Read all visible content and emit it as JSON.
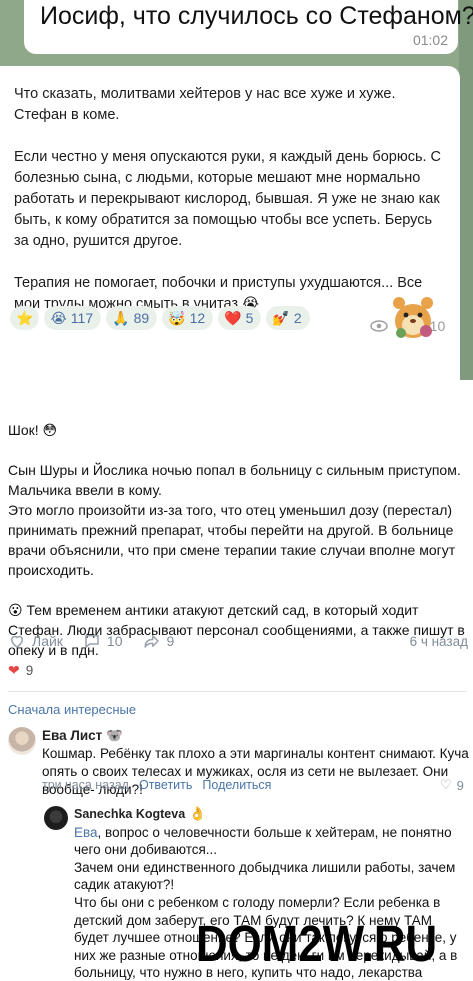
{
  "telegram": {
    "question": "Иосиф, что случилось со Стефаном?",
    "question_time": "01:02",
    "message_paragraphs": [
      "Что сказать, молитвами хейтеров у нас все хуже и хуже. Стефан в коме.",
      "Если честно у меня опускаются руки, я каждый день борюсь. С болезнью сына, с людьми, которые мешают мне нормально работать и перекрывают кислород, бывшая. Я уже не знаю как быть, к кому обратится за помощью чтобы все успеть. Берусь за одно, рушится другое.",
      "Терапия не помогает, побочки и приступы ухудшаются...  Все мои труды можно смыть в унитаз 😭"
    ],
    "reactions": [
      {
        "emoji": "⭐",
        "count": ""
      },
      {
        "emoji": "😭",
        "count": "117"
      },
      {
        "emoji": "🙏",
        "count": "89"
      },
      {
        "emoji": "🤯",
        "count": "12"
      },
      {
        "emoji": "❤️",
        "count": "5"
      },
      {
        "emoji": "💅",
        "count": "2"
      }
    ],
    "message_time": "1:10",
    "icons": {
      "views": "eye-icon",
      "sticker": "hamster-sticker-icon"
    }
  },
  "post": {
    "line1": "Шок! 😳",
    "para1": "Сын Шуры и Йослика ночью попал в больницу с сильным приступом. Мальчика ввели в кому.",
    "para2": "Это могло произойти из-за того, что отец уменьшил дозу (перестал) принимать прежний препарат, чтобы перейти на другой. В больнице врачи объяснили, что при смене терапии такие случаи вполне могут происходить.",
    "para3": "😮 Тем временем антики атакуют детский сад, в который ходит Стефан. Люди забрасывают персонал сообщениями, а также пишут в опеку и в пдн."
  },
  "actions": {
    "like_label": "Лайк",
    "comments_count": "10",
    "shares_count": "9",
    "time": "6 ч назад",
    "likes_count": "9"
  },
  "comments": {
    "sort_label": "Сначала интересные",
    "first": {
      "author": "Ева Лист",
      "author_badge": "🐨",
      "text": "Кошмар. Ребёнку так плохо а эти маргиналы контент снимают. Куча опять о своих телесах и мужиках, осля из сети не вылезает. Они вообще- люди?!",
      "time": "три часа назад",
      "reply_label": "Ответить",
      "share_label": "Поделиться",
      "likes": "9"
    },
    "second": {
      "author": "Sanechka Kogteva",
      "author_badge": "👌",
      "mention": "Ева",
      "text_line1": ", вопрос о человечности больше к хейтерам, не понятно чего они добиваются...",
      "text_line2": "Зачем они единственного добыдчика лишили работы, зачем садик атакуют?!",
      "text_line3": "Что бы они с ребенком с голоду померли? Если ребенка в детский дом заберут, его ТАМ будут лечить? К нему ТАМ будет лучшее отношение? Если они так пекутся о ребенке, у них же разные отношения, то не деньги им перекидывай, а в больницу, что нужно в него, купить что надо, лекарства купить, что надо, и продукты и оказать это по ребенку, вот это была бы помощь!"
    }
  },
  "watermark": "DOM2W.RU"
}
